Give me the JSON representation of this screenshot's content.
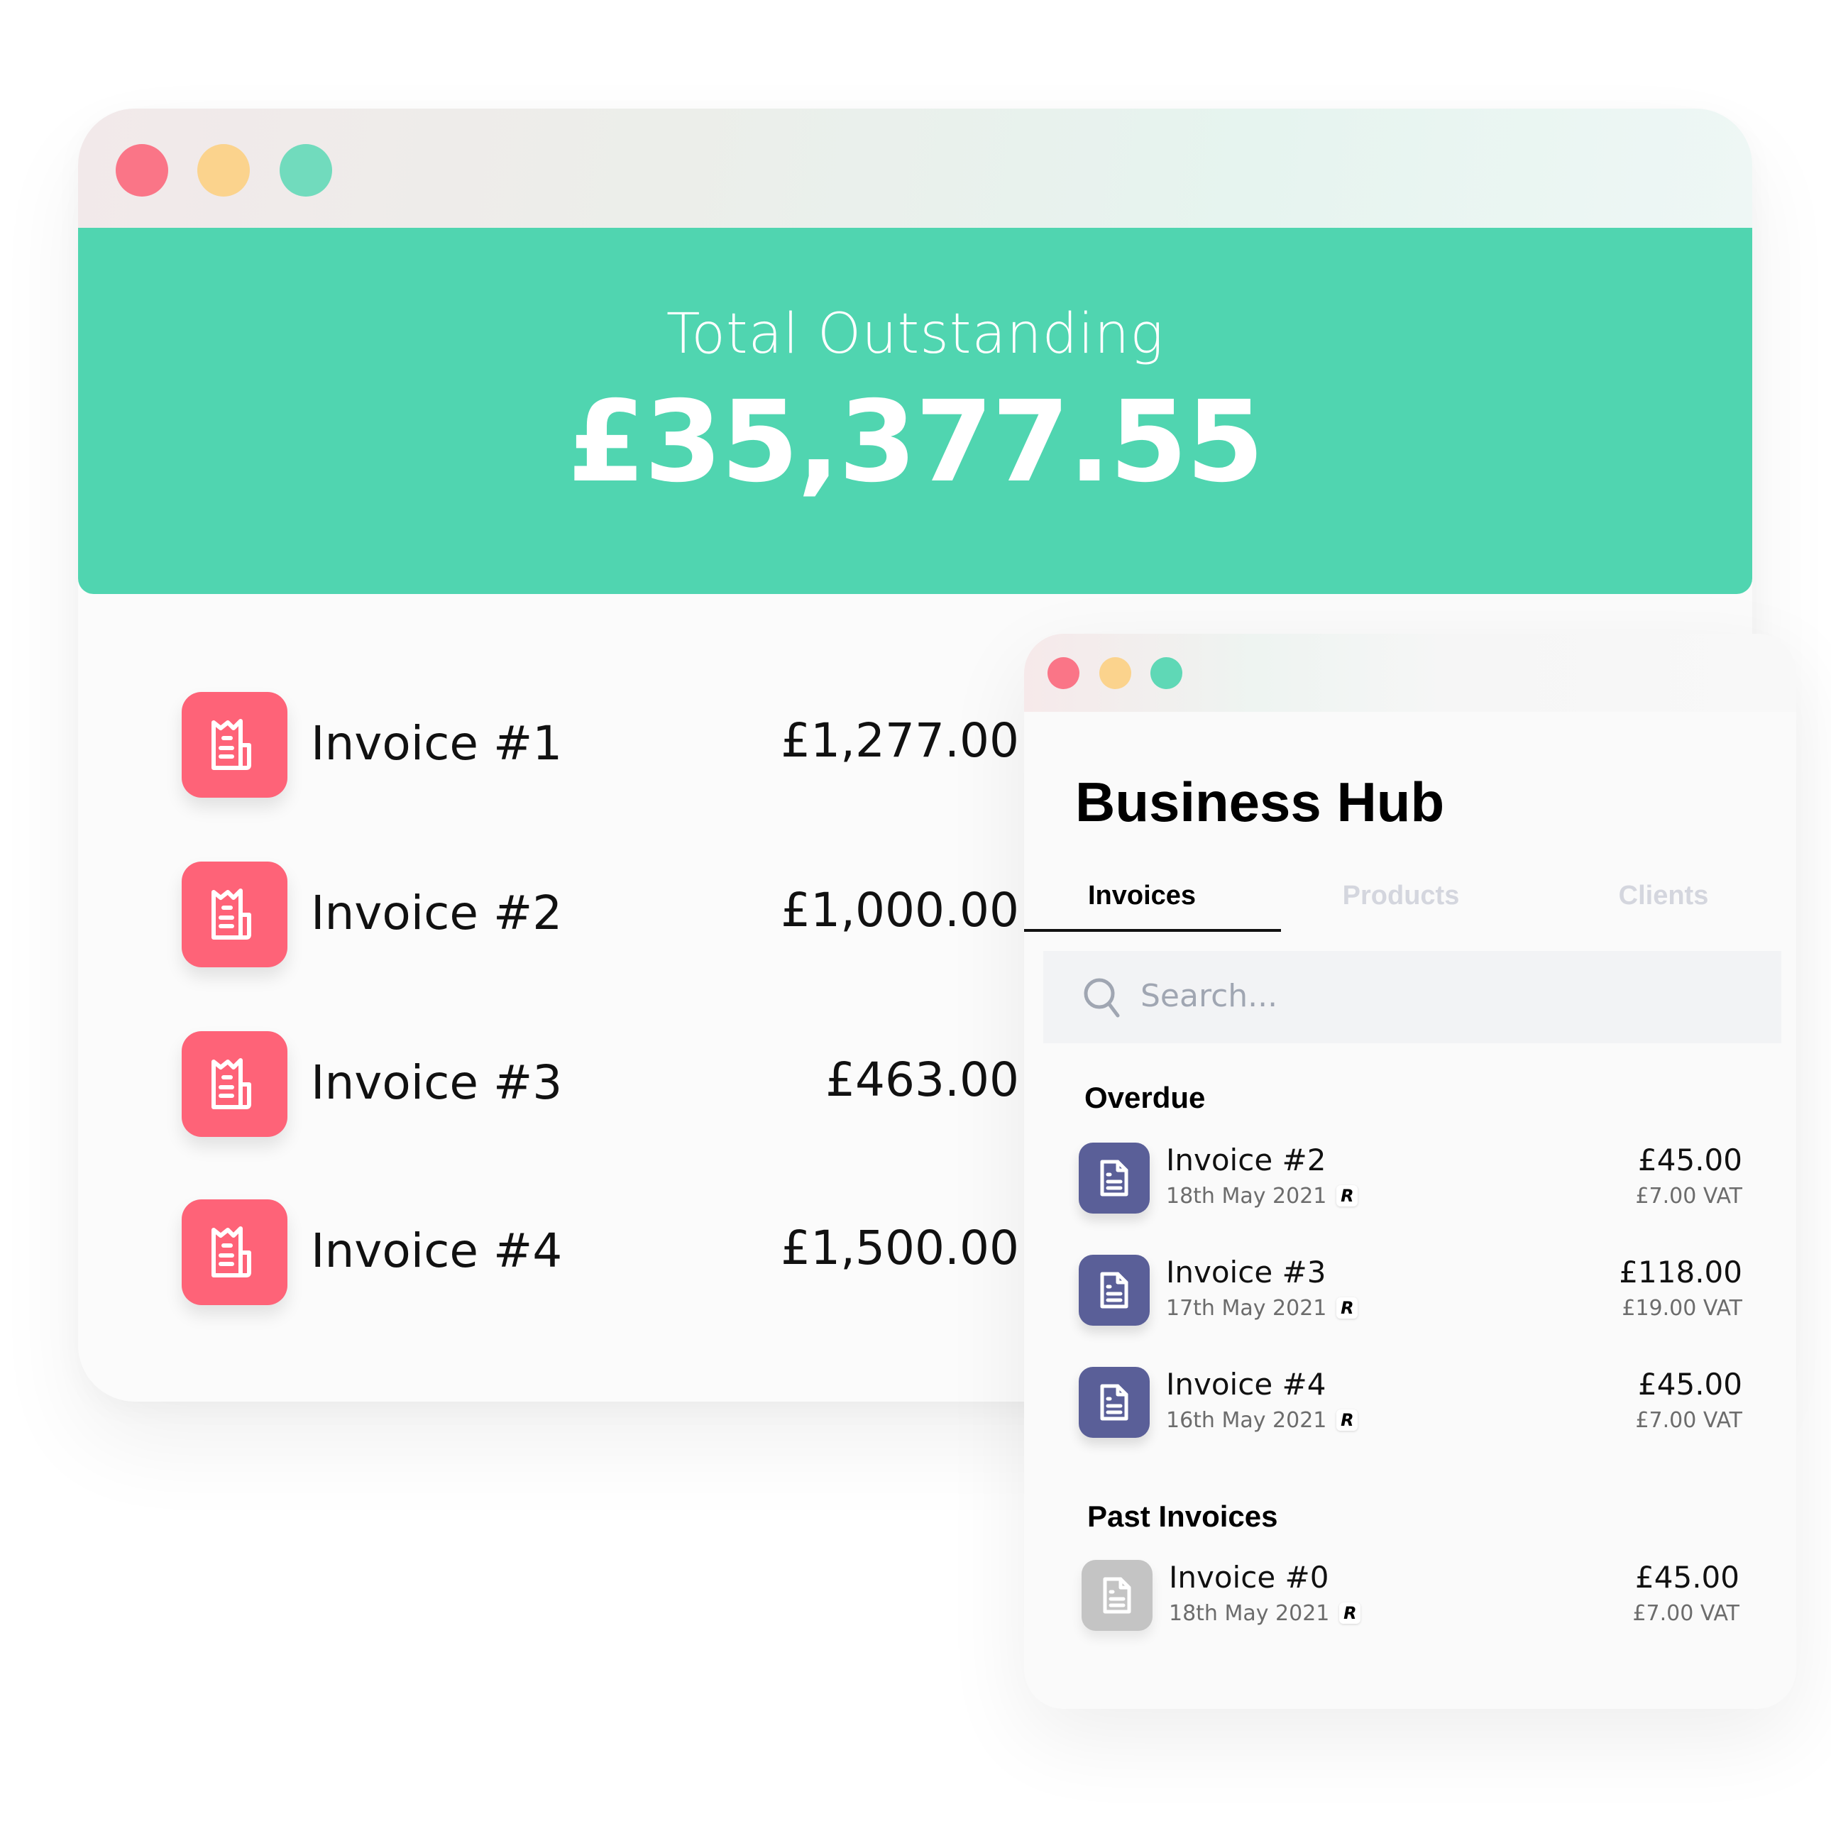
{
  "colors": {
    "accent_green": "#50d5b0",
    "invoice_red": "#fe6378",
    "overdue_purple": "#5a5f98",
    "past_grey": "#c4c4c4",
    "dot_red": "#fa7587",
    "dot_yellow": "#fbd38d",
    "dot_green": "#71dbbd"
  },
  "main_window": {
    "header": {
      "label": "Total Outstanding",
      "amount": "£35,377.55"
    },
    "invoices": [
      {
        "icon": "receipt-icon",
        "name": "Invoice #1",
        "amount": "£1,277.00"
      },
      {
        "icon": "receipt-icon",
        "name": "Invoice #2",
        "amount": "£1,000.00"
      },
      {
        "icon": "receipt-icon",
        "name": "Invoice #3",
        "amount": "£463.00"
      },
      {
        "icon": "receipt-icon",
        "name": "Invoice #4",
        "amount": "£1,500.00"
      }
    ]
  },
  "hub": {
    "title": "Business Hub",
    "tabs": [
      {
        "label": "Invoices",
        "active": true
      },
      {
        "label": "Products",
        "active": false
      },
      {
        "label": "Clients",
        "active": false
      }
    ],
    "search": {
      "placeholder": "Search..."
    },
    "sections": {
      "overdue": {
        "title": "Overdue",
        "items": [
          {
            "name": "Invoice #2",
            "date": "18th May 2021",
            "badge": "R",
            "amount": "£45.00",
            "vat": "£7.00 VAT"
          },
          {
            "name": "Invoice #3",
            "date": "17th May 2021",
            "badge": "R",
            "amount": "£118.00",
            "vat": "£19.00 VAT"
          },
          {
            "name": "Invoice #4",
            "date": "16th May 2021",
            "badge": "R",
            "amount": "£45.00",
            "vat": "£7.00 VAT"
          }
        ]
      },
      "past": {
        "title": "Past Invoices",
        "items": [
          {
            "name": "Invoice #0",
            "date": "18th May 2021",
            "badge": "R",
            "amount": "£45.00",
            "vat": "£7.00 VAT"
          }
        ]
      }
    }
  }
}
